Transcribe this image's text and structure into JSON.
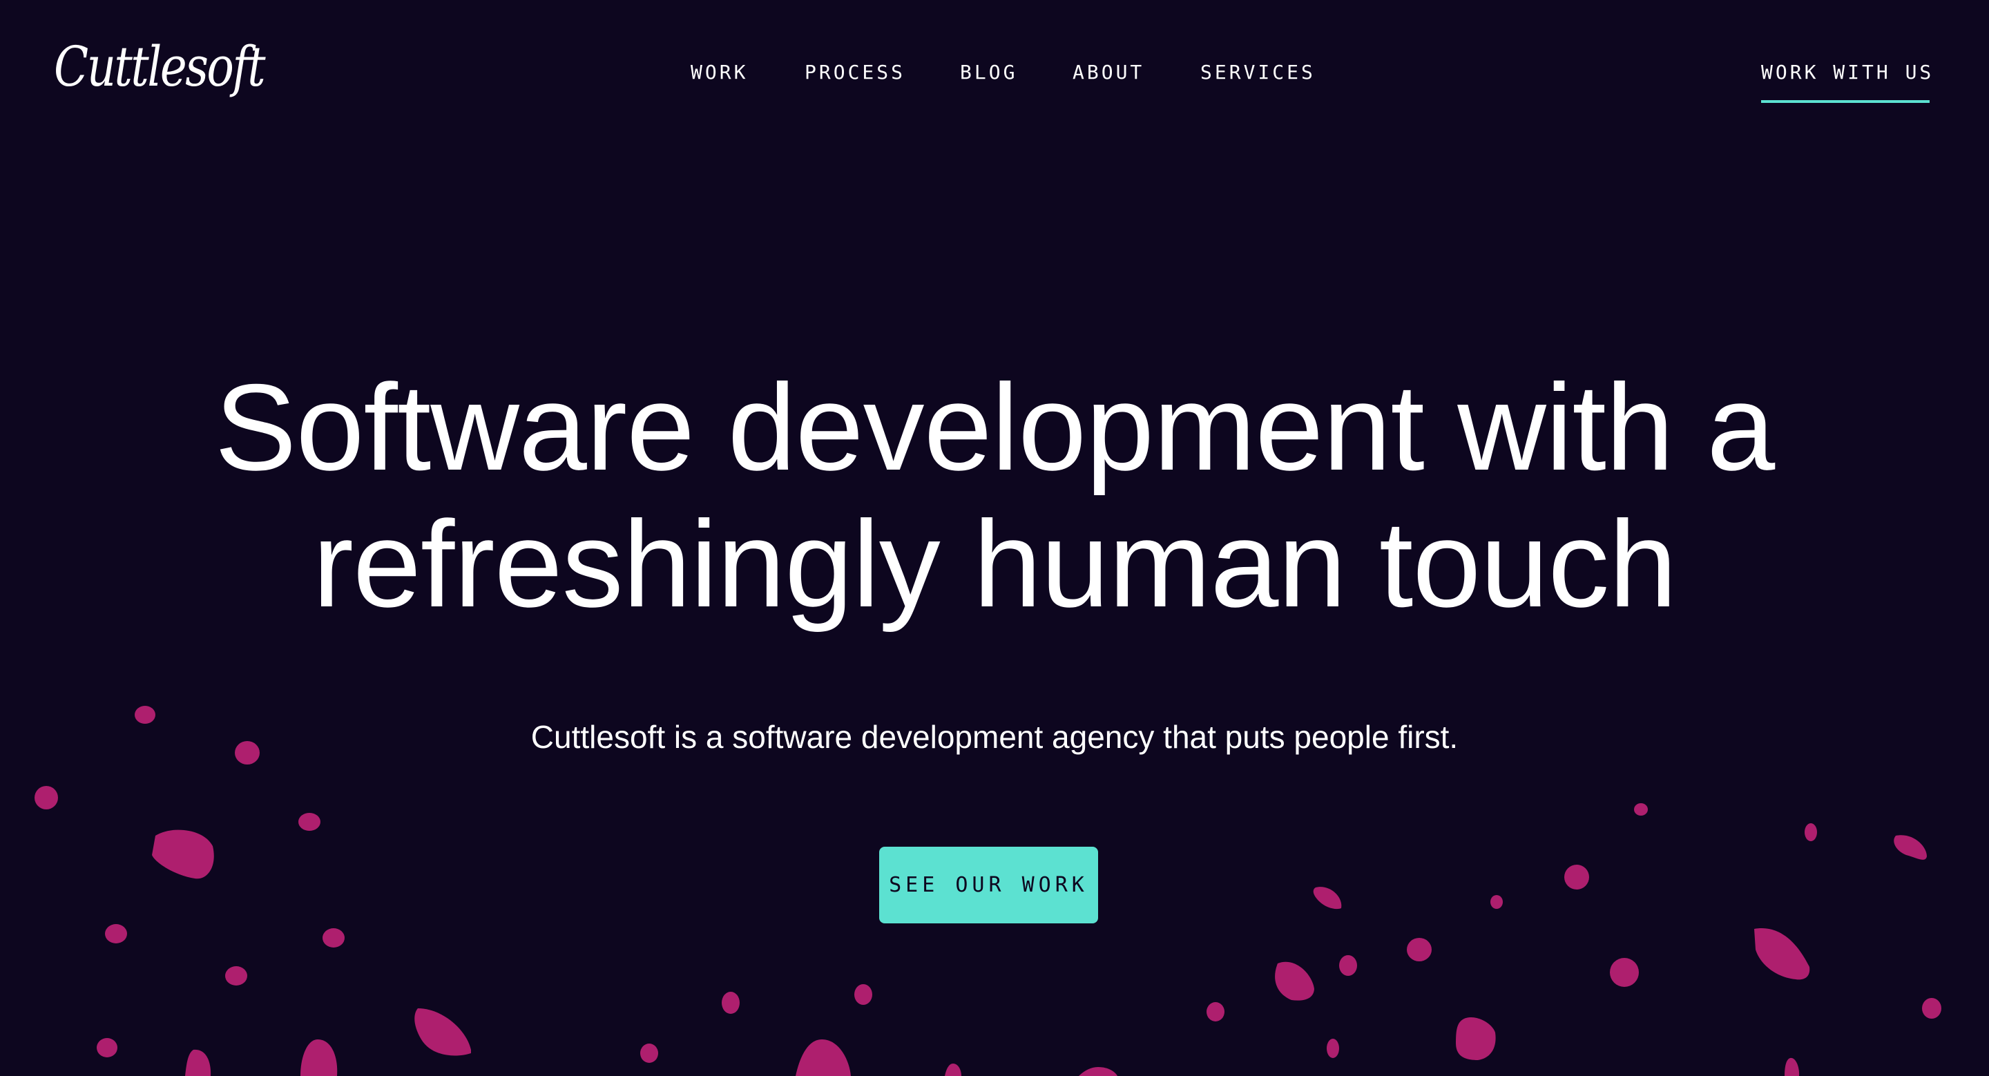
{
  "brand": {
    "logo_text": "Cuttlesoft"
  },
  "nav": {
    "items": [
      {
        "label": "WORK"
      },
      {
        "label": "PROCESS"
      },
      {
        "label": "BLOG"
      },
      {
        "label": "ABOUT"
      },
      {
        "label": "SERVICES"
      }
    ],
    "cta_label": "WORK WITH US"
  },
  "hero": {
    "headline_line1": "Software development with a",
    "headline_line2": "refreshingly human touch",
    "subtitle": "Cuttlesoft is a software development agency that puts people first.",
    "button_label": "SEE OUR WORK"
  },
  "colors": {
    "background": "#0d061f",
    "accent": "#5ce1d1",
    "blob": "#ae1f6e",
    "text": "#ffffff"
  }
}
